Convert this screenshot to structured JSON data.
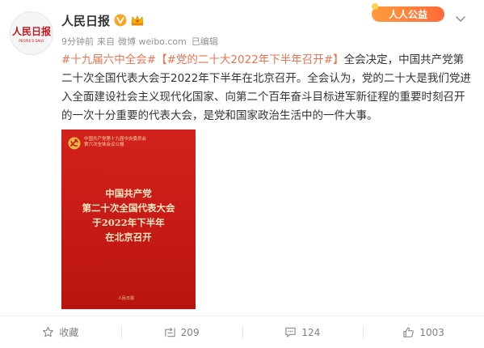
{
  "post": {
    "author": "人民日报",
    "avatar_brand": "人民日报",
    "avatar_sub": "PEOPLE'S DAILY",
    "time": "9分钟前",
    "source_prefix": "来自",
    "source": "微博 weibo.com",
    "edited": "已编辑",
    "charity_label": "人人公益",
    "topic1": "#十九届六中全会#",
    "topic2": "【#党的二十大2022年下半年召开#】",
    "body": "全会决定，中国共产党第二十次全国代表大会于2022年下半年在北京召开。全会认为，党的二十大是我们党进入全面建设社会主义现代化国家、向第二个百年奋斗目标进军新征程的重要时刻召开的一次十分重要的代表大会，是党和国家政治生活中的一件大事。"
  },
  "poster": {
    "top_line1": "中国共产党第十九届中央委员会",
    "top_line2": "第六次全体会议公报",
    "line1": "中国共产党",
    "line2": "第二十次全国代表大会",
    "line3": "于2022年下半年",
    "line4": "在北京召开",
    "footer": "人民日报"
  },
  "actions": {
    "favorite_label": "收藏",
    "repost_count": "209",
    "comment_count": "124",
    "like_count": "1003"
  },
  "colors": {
    "link": "#eb7350",
    "poster_red": "#c61a16",
    "verified": "#f6a623"
  },
  "icons": [
    "verified-icon",
    "crown-icon",
    "chevron-down-icon",
    "star-icon",
    "repost-icon",
    "comment-icon",
    "like-icon",
    "party-emblem-icon"
  ]
}
